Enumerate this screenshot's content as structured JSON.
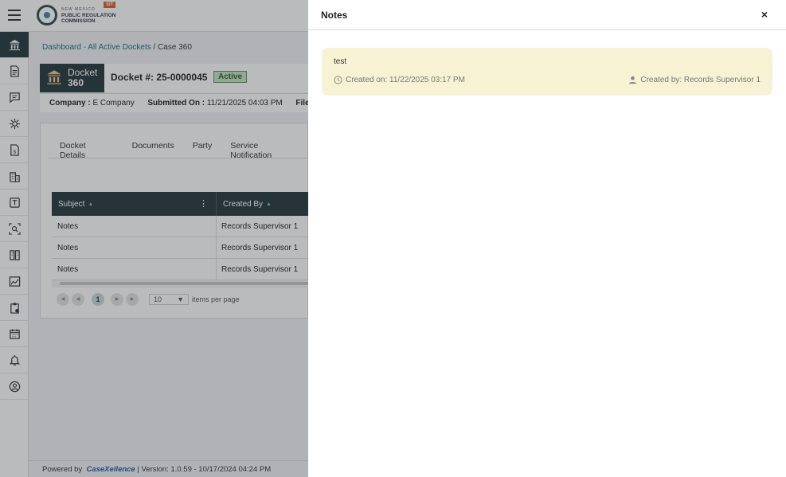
{
  "app": {
    "logo": {
      "line1": "NEW MEXICO",
      "line2": "PUBLIC REGULATION",
      "line3": "COMMISSION",
      "badge": "SIT"
    },
    "sidebar_icons": [
      "bank-icon",
      "document-icon",
      "chat-icon",
      "gear-cog-icon",
      "invoice-icon",
      "building-icon",
      "form-icon",
      "search-scan-icon",
      "book-icon",
      "chart-icon",
      "clipboard-icon",
      "calendar-icon",
      "bell-icon",
      "user-circle-icon"
    ]
  },
  "breadcrumb": {
    "link": "Dashboard - All Active Dockets",
    "sep": " / ",
    "current": "Case 360"
  },
  "docket": {
    "label_top": "Docket",
    "label_bottom": "360",
    "number": "Docket #: 25-0000045",
    "status": "Active",
    "company_label": "Company :",
    "company_value": "E Company",
    "submitted_label": "Submitted On :",
    "submitted_value": "11/21/2025 04:03 PM",
    "filed_label": "File"
  },
  "tabs": [
    "Docket Details",
    "Documents",
    "Party",
    "Service Notification"
  ],
  "grid": {
    "columns": [
      "Subject",
      "Created By"
    ],
    "rows": [
      [
        "Notes",
        "Records Supervisor 1"
      ],
      [
        "Notes",
        "Records Supervisor 1"
      ],
      [
        "Notes",
        "Records Supervisor 1"
      ]
    ],
    "pager": {
      "current_page": "1",
      "page_size": "10",
      "page_size_label": "items per page"
    }
  },
  "footer": {
    "powered_by": "Powered by",
    "brand": "CaseXellence",
    "sep": " | ",
    "version": "Version: 1.0.59 - 10/17/2024 04:24 PM"
  },
  "drawer": {
    "title": "Notes",
    "close_label": "×",
    "note": {
      "text": "test",
      "created_on": "Created on: 11/22/2025 03:17 PM",
      "created_by": "Created by: Records Supervisor 1"
    }
  },
  "colors": {
    "accent_dark": "#24383c",
    "note_bg": "#f6f2d3",
    "link": "#1c6f85"
  }
}
